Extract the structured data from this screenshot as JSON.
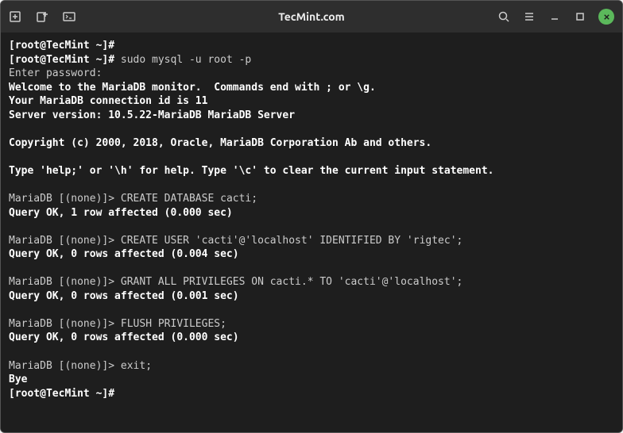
{
  "titlebar": {
    "title": "TecMint.com"
  },
  "terminal": {
    "lines": [
      {
        "bold": true,
        "text": "[root@TecMint ~]#"
      },
      {
        "segments": [
          {
            "bold": true,
            "text": "[root@TecMint ~]# "
          },
          {
            "bold": false,
            "text": "sudo mysql -u root -p"
          }
        ]
      },
      {
        "bold": false,
        "text": "Enter password: "
      },
      {
        "bold": true,
        "text": "Welcome to the MariaDB monitor.  Commands end with ; or \\g."
      },
      {
        "bold": true,
        "text": "Your MariaDB connection id is 11"
      },
      {
        "bold": true,
        "text": "Server version: 10.5.22-MariaDB MariaDB Server"
      },
      {
        "bold": true,
        "text": ""
      },
      {
        "bold": true,
        "text": "Copyright (c) 2000, 2018, Oracle, MariaDB Corporation Ab and others."
      },
      {
        "bold": true,
        "text": ""
      },
      {
        "bold": true,
        "text": "Type 'help;' or '\\h' for help. Type '\\c' to clear the current input statement."
      },
      {
        "bold": true,
        "text": ""
      },
      {
        "segments": [
          {
            "bold": false,
            "text": "MariaDB [(none)]> "
          },
          {
            "bold": false,
            "text": "CREATE DATABASE cacti;"
          }
        ]
      },
      {
        "bold": true,
        "text": "Query OK, 1 row affected (0.000 sec)"
      },
      {
        "bold": true,
        "text": ""
      },
      {
        "segments": [
          {
            "bold": false,
            "text": "MariaDB [(none)]> "
          },
          {
            "bold": false,
            "text": "CREATE USER 'cacti'@'localhost' IDENTIFIED BY 'rigtec';"
          }
        ]
      },
      {
        "bold": true,
        "text": "Query OK, 0 rows affected (0.004 sec)"
      },
      {
        "bold": true,
        "text": ""
      },
      {
        "segments": [
          {
            "bold": false,
            "text": "MariaDB [(none)]> "
          },
          {
            "bold": false,
            "text": "GRANT ALL PRIVILEGES ON cacti.* TO 'cacti'@'localhost';"
          }
        ]
      },
      {
        "bold": true,
        "text": "Query OK, 0 rows affected (0.001 sec)"
      },
      {
        "bold": true,
        "text": ""
      },
      {
        "segments": [
          {
            "bold": false,
            "text": "MariaDB [(none)]> "
          },
          {
            "bold": false,
            "text": "FLUSH PRIVILEGES;"
          }
        ]
      },
      {
        "bold": true,
        "text": "Query OK, 0 rows affected (0.000 sec)"
      },
      {
        "bold": true,
        "text": ""
      },
      {
        "segments": [
          {
            "bold": false,
            "text": "MariaDB [(none)]> "
          },
          {
            "bold": false,
            "text": "exit;"
          }
        ]
      },
      {
        "bold": true,
        "text": "Bye"
      },
      {
        "bold": true,
        "text": "[root@TecMint ~]#"
      }
    ]
  }
}
